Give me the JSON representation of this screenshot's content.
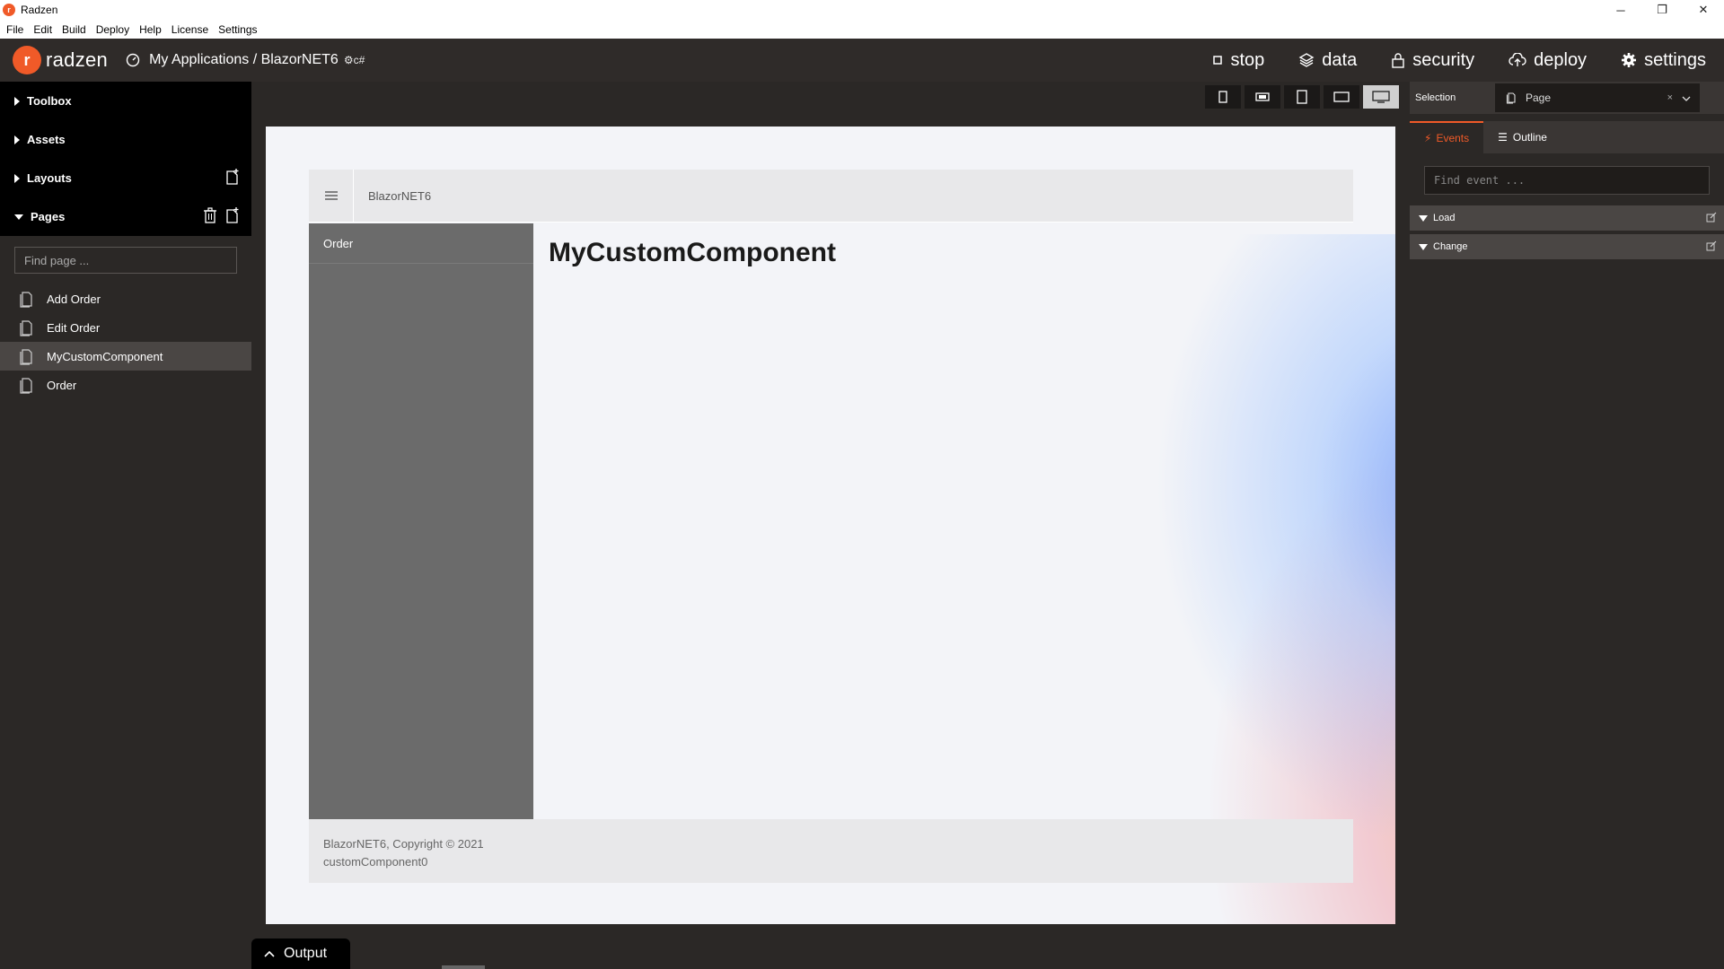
{
  "window": {
    "title": "Radzen",
    "minimize": "─",
    "maximize": "❐",
    "close": "✕"
  },
  "menu": [
    "File",
    "Edit",
    "Build",
    "Deploy",
    "Help",
    "License",
    "Settings"
  ],
  "header": {
    "logo_text": "radzen",
    "breadcrumb": "My Applications / BlazorNET6",
    "breadcrumb_suffix": "c#",
    "actions": {
      "stop": "stop",
      "data": "data",
      "security": "security",
      "deploy": "deploy",
      "settings": "settings"
    }
  },
  "sidebar": {
    "sections": {
      "toolbox": "Toolbox",
      "assets": "Assets",
      "layouts": "Layouts",
      "pages": "Pages"
    },
    "find_placeholder": "Find page ...",
    "pages": [
      "Add Order",
      "Edit Order",
      "MyCustomComponent",
      "Order"
    ],
    "active_page_index": 2
  },
  "canvas": {
    "app_title": "BlazorNET6",
    "nav_items": [
      "Order"
    ],
    "heading": "MyCustomComponent",
    "footer_line1": "BlazorNET6, Copyright © 2021",
    "footer_line2": "customComponent0"
  },
  "output": {
    "label": "Output"
  },
  "right_panel": {
    "selection_label": "Selection",
    "selection_value": "Page",
    "selection_clear": "×",
    "tabs": {
      "events": "Events",
      "outline": "Outline"
    },
    "find_event_placeholder": "Find event ...",
    "events": [
      "Load",
      "Change"
    ]
  },
  "colors": {
    "accent": "#f05a28",
    "dark_bg": "#2b2826",
    "header_bg": "#2f2b29",
    "app_sidebar": "#6b6b6b"
  }
}
